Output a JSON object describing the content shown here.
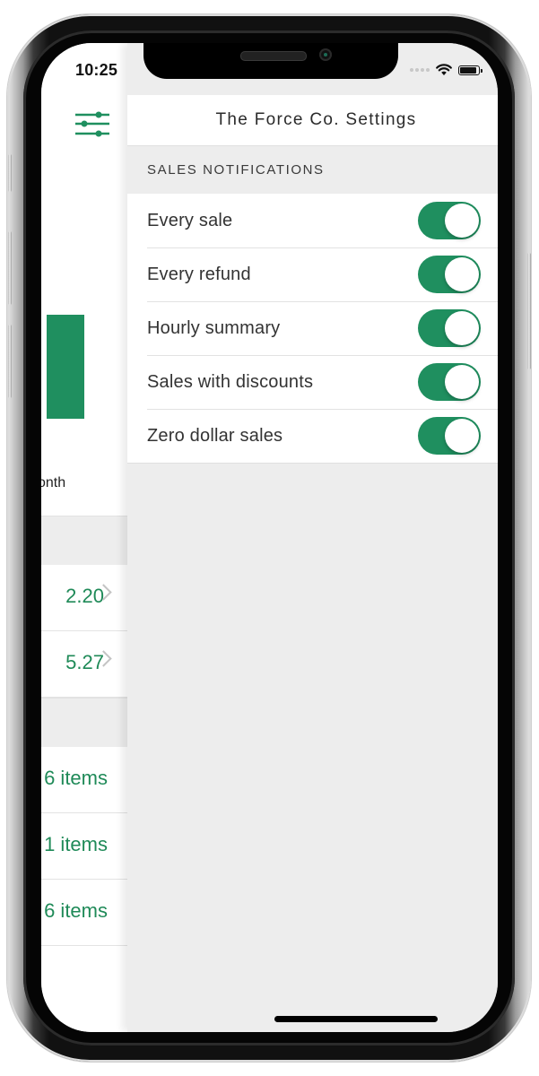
{
  "status_bar": {
    "time": "10:25",
    "icons": [
      "signal-dots-icon",
      "wifi-icon",
      "battery-icon"
    ]
  },
  "left_panel": {
    "menu_icon": "sliders-filter-icon",
    "period_label_fragment": "onth",
    "values": [
      {
        "text": "2.20",
        "has_chevron": true
      },
      {
        "text": "5.27",
        "has_chevron": true
      }
    ],
    "items": [
      {
        "text": "6 items"
      },
      {
        "text": "1 items"
      },
      {
        "text": "6 items"
      }
    ]
  },
  "settings": {
    "title": "The Force Co. Settings",
    "section_header": "SALES NOTIFICATIONS",
    "toggles": [
      {
        "label": "Every sale",
        "on": true
      },
      {
        "label": "Every refund",
        "on": true
      },
      {
        "label": "Hourly summary",
        "on": true
      },
      {
        "label": "Sales with discounts",
        "on": true
      },
      {
        "label": "Zero dollar sales",
        "on": true
      }
    ]
  },
  "colors": {
    "accent": "#1f8f5f",
    "value_text": "#1f8a58",
    "background": "#ededed"
  }
}
